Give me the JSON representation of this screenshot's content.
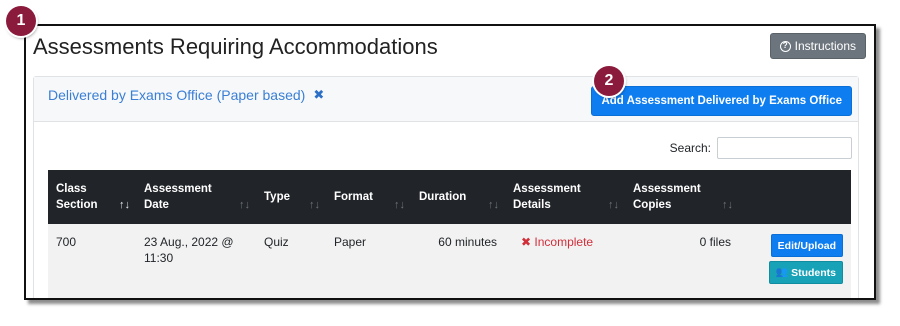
{
  "markers": [
    "1",
    "2"
  ],
  "header": {
    "title": "Assessments Requiring Accommodations",
    "instructions_label": "Instructions",
    "instructions_icon": "question-circle-icon"
  },
  "filter": {
    "label": "Delivered by Exams Office (Paper based)",
    "remove_icon": "close-icon"
  },
  "add_button_label": "Add Assessment Delivered by Exams Office",
  "search": {
    "label": "Search:",
    "value": ""
  },
  "table": {
    "columns": [
      "Class\nSection",
      "Assessment\nDate",
      "Type",
      "Format",
      "Duration",
      "Assessment\nDetails",
      "Assessment\nCopies",
      ""
    ],
    "rows": [
      {
        "class_section": "700",
        "date": "23 Aug., 2022 @\n11:30",
        "type": "Quiz",
        "format": "Paper",
        "duration": "60 minutes",
        "details": "Incomplete",
        "copies": "0 files",
        "edit_label": "Edit/Upload",
        "students_label": "Students"
      }
    ]
  },
  "colors": {
    "accent_blue": "#0d7df0",
    "teal": "#17a2b8",
    "header_dark": "#212529",
    "danger": "#d12e3a",
    "marker": "#8a1b3c"
  }
}
